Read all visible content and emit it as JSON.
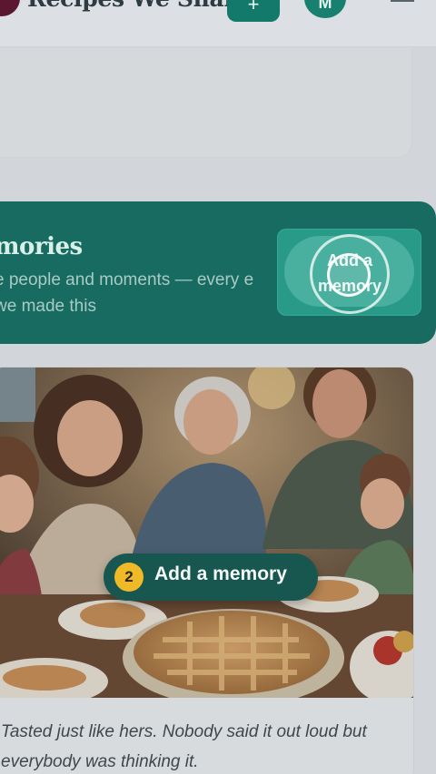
{
  "header": {
    "app_title": "Recipes We Share",
    "add_label": "+",
    "avatar_initial": "M"
  },
  "banner": {
    "title": "emories",
    "subtitle": "e people and moments — every e we made this",
    "button_label": "Add a memory"
  },
  "memory": {
    "caption": "Tasted just like hers. Nobody said it out loud but everybody was thinking it."
  },
  "tooltip": {
    "step": "2",
    "label": "Add a memory"
  },
  "colors": {
    "accent": "#176b61",
    "step_badge": "#f0b928"
  }
}
